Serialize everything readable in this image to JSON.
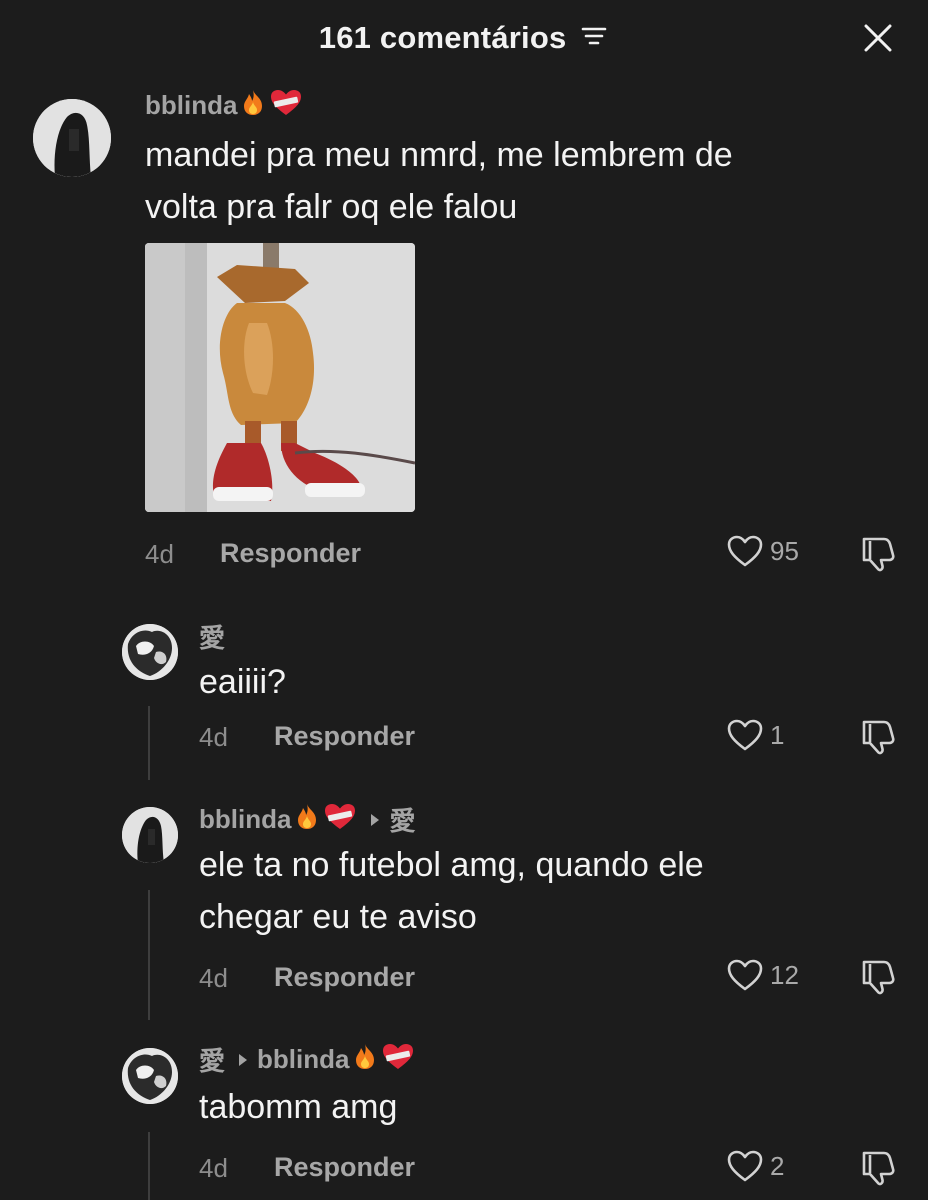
{
  "header": {
    "title": "161 comentários"
  },
  "comments": [
    {
      "username": "bblinda",
      "text_lines": [
        "mandei pra meu nmrd, me lembrem de",
        "volta pra falr oq ele falou"
      ],
      "time": "4d",
      "reply_label": "Responder",
      "likes": "95"
    }
  ],
  "replies": [
    {
      "username": "愛",
      "text_lines": [
        "eaiiii?"
      ],
      "time": "4d",
      "reply_label": "Responder",
      "likes": "1"
    },
    {
      "username": "bblinda",
      "reply_to": "愛",
      "text_lines": [
        "ele ta no futebol amg, quando ele",
        "chegar eu te aviso"
      ],
      "time": "4d",
      "reply_label": "Responder",
      "likes": "12"
    },
    {
      "username": "愛",
      "reply_to": "bblinda",
      "text_lines": [
        "tabomm amg"
      ],
      "time": "4d",
      "reply_label": "Responder",
      "likes": "2"
    }
  ],
  "colors": {
    "background": "#1c1c1c",
    "username": "#a4a4a4",
    "text": "#f3f3f3",
    "muted": "#8d8d8d"
  }
}
